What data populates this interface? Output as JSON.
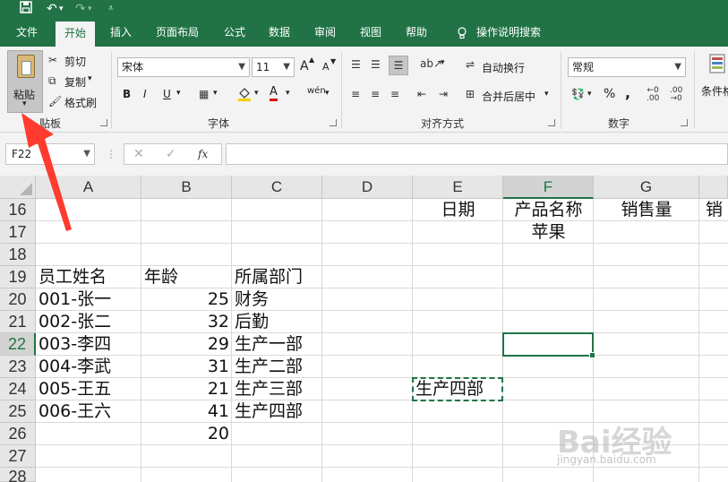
{
  "quick_access": {
    "save_icon": "save-icon",
    "undo_icon": "undo-icon",
    "redo_icon": "redo-icon",
    "customize_icon": "customize-icon"
  },
  "tabs": [
    "文件",
    "开始",
    "插入",
    "页面布局",
    "公式",
    "数据",
    "审阅",
    "视图",
    "帮助"
  ],
  "active_tab": "开始",
  "tell_me": "操作说明搜索",
  "clipboard": {
    "paste": "粘贴",
    "cut": "剪切",
    "copy": "复制",
    "format_painter": "格式刷",
    "label": "贴板"
  },
  "font": {
    "name": "宋体",
    "size": "11",
    "grow": "A",
    "shrink": "A",
    "bold": "B",
    "italic": "I",
    "underline": "U",
    "color_letter": "A",
    "wen": "wén",
    "label": "字体"
  },
  "alignment": {
    "wrap": "自动换行",
    "merge": "合并后居中",
    "label": "对齐方式"
  },
  "number": {
    "format": "常规",
    "percent": "%",
    "comma": ",",
    "label": "数字"
  },
  "styles": {
    "conditional": "条件格"
  },
  "name_box": "F22",
  "fx": "fx",
  "formula_value": "",
  "columns": [
    {
      "label": "A"
    },
    {
      "label": "B"
    },
    {
      "label": "C"
    },
    {
      "label": "D"
    },
    {
      "label": "E"
    },
    {
      "label": "F"
    },
    {
      "label": "G"
    },
    {
      "label": "H"
    }
  ],
  "selected_column": "F",
  "rows": [
    "16",
    "17",
    "18",
    "19",
    "20",
    "21",
    "22",
    "23",
    "24",
    "25",
    "26",
    "27",
    "28"
  ],
  "selected_row": "22",
  "cells": {
    "E16": "日期",
    "F16": "产品名称",
    "G16": "销售量",
    "H16": "销",
    "F17": "苹果",
    "A19": "员工姓名",
    "B19": "年龄",
    "C19": "所属部门",
    "A20": "001-张一",
    "B20": "25",
    "C20": "财务",
    "A21": "002-张二",
    "B21": "32",
    "C21": "后勤",
    "A22": "003-李四",
    "B22": "29",
    "C22": "生产一部",
    "A23": "004-李武",
    "B23": "31",
    "C23": "生产二部",
    "A24": "005-王五",
    "B24": "21",
    "C24": "生产三部",
    "E24": "生产四部",
    "A25": "006-王六",
    "B25": "41",
    "C25": "生产四部",
    "B26": "20"
  },
  "accent_color": "#217346",
  "arrow_color": "#ff3b2f",
  "watermark": "Bai经验",
  "watermark_sub": "jingyan.baidu.com"
}
